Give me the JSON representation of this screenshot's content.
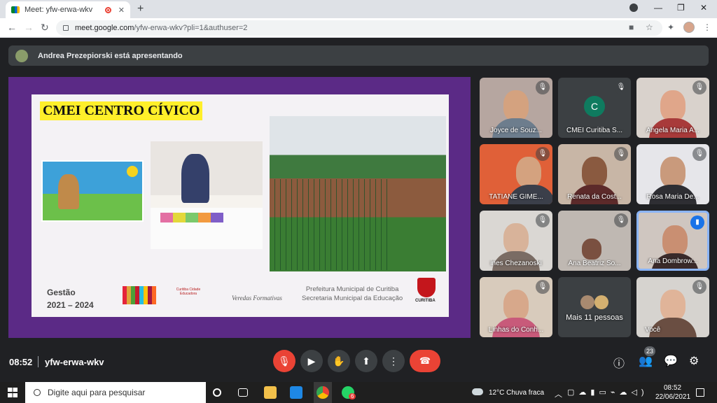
{
  "browser": {
    "tab_title": "Meet: yfw-erwa-wkv",
    "url_domain": "meet.google.com",
    "url_path": "/yfw-erwa-wkv?pli=1&authuser=2"
  },
  "presenting_bar": {
    "text": "Andrea Prezepiorski está apresentando"
  },
  "slide": {
    "title": "CMEI CENTRO CÍVICO",
    "gestao_label": "Gestão",
    "gestao_years": "2021 – 2024",
    "logo1": "Curitiba Cidade Educadora",
    "logo2": "Veredas Formativas",
    "pref_line1": "Prefeitura Municipal de Curitiba",
    "pref_line2": "Secretaria Municipal da Educação",
    "shield_label": "CURITIBA"
  },
  "participants": [
    {
      "name": "Joyce de Souz..."
    },
    {
      "name": "CMEI Curitiba S...",
      "initial": "C"
    },
    {
      "name": "Angela Maria A..."
    },
    {
      "name": "TATIANE GIME..."
    },
    {
      "name": "Renata da Cost..."
    },
    {
      "name": "Rosa Maria De..."
    },
    {
      "name": "ines Chezanoski"
    },
    {
      "name": "Ana Beatriz So..."
    },
    {
      "name": "Ana Dombrow..."
    },
    {
      "name": "Linhas do Conh..."
    },
    {
      "name": "Mais 11 pessoas"
    },
    {
      "name": "Você"
    }
  ],
  "controls": {
    "time": "08:52",
    "meeting_code": "yfw-erwa-wkv",
    "people_count": "23"
  },
  "taskbar": {
    "search_placeholder": "Digite aqui para pesquisar",
    "weather": "12°C  Chuva fraca",
    "clock_time": "08:52",
    "clock_date": "22/06/2021",
    "whatsapp_badge": "6"
  },
  "colors": {
    "stage_purple": "#5b2a86",
    "title_highlight": "#ffef2a",
    "end_call_red": "#ea4335",
    "speaking_blue": "#1a73e8"
  }
}
